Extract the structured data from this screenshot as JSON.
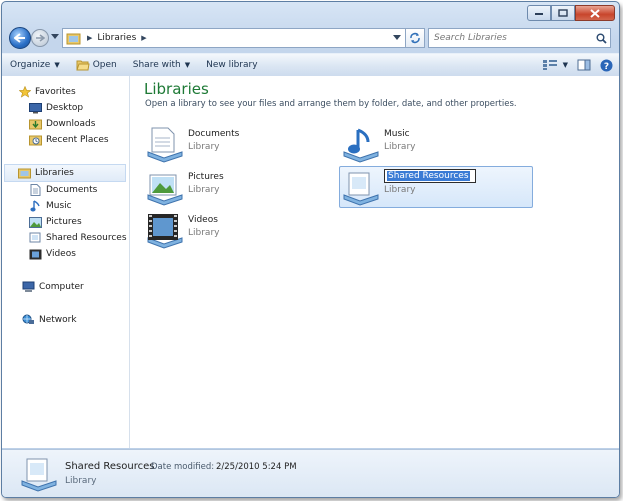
{
  "window": {
    "caption": {
      "minimize": "minimize-icon",
      "maximize": "maximize-icon",
      "close": "close-icon"
    }
  },
  "address_bar": {
    "breadcrumb": [
      "Libraries"
    ],
    "separator": "▶",
    "search_placeholder": "Search Libraries"
  },
  "toolbar": {
    "organize": "Organize",
    "open": "Open",
    "share_with": "Share with",
    "new_library": "New library"
  },
  "nav_pane": {
    "favorites": {
      "label": "Favorites",
      "items": [
        "Desktop",
        "Downloads",
        "Recent Places"
      ]
    },
    "libraries": {
      "label": "Libraries",
      "items": [
        "Documents",
        "Music",
        "Pictures",
        "Shared Resources",
        "Videos"
      ]
    },
    "computer": "Computer",
    "network": "Network"
  },
  "content": {
    "title": "Libraries",
    "subtitle": "Open a library to see your files and arrange them by folder, date, and other properties.",
    "libraries": [
      {
        "name": "Documents",
        "type": "Library"
      },
      {
        "name": "Music",
        "type": "Library"
      },
      {
        "name": "Pictures",
        "type": "Library"
      },
      {
        "name": "Shared Resources",
        "type": "Library",
        "renaming": true
      },
      {
        "name": "Videos",
        "type": "Library"
      }
    ]
  },
  "details_pane": {
    "name": "Shared Resources",
    "modified_label": "Date modified:",
    "modified_value": "2/25/2010 5:24 PM",
    "type": "Library"
  },
  "colors": {
    "title_green": "#1e7a36",
    "selection_blue": "#3a7bd5",
    "close_red": "#c8452c"
  }
}
